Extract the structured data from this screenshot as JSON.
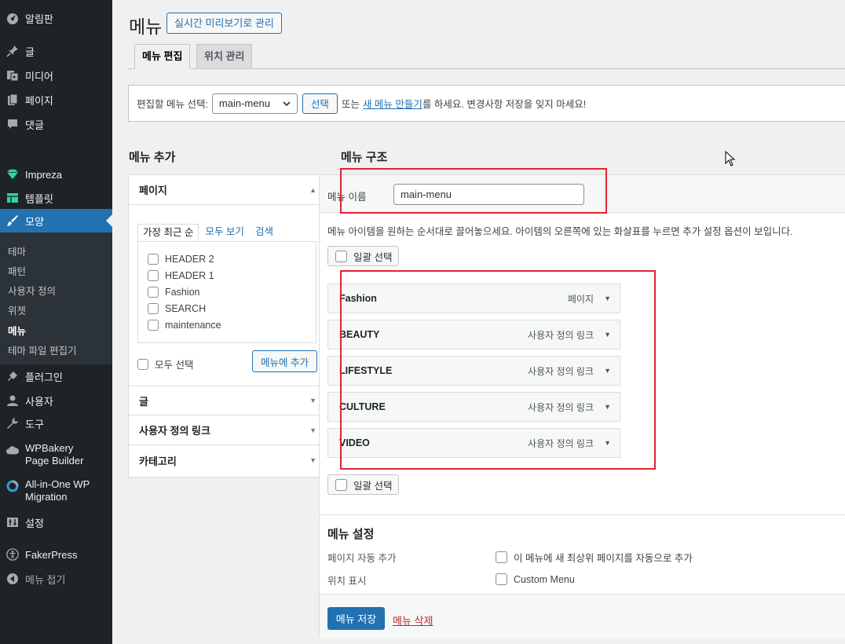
{
  "sidebar": {
    "items": [
      {
        "label": "알림판",
        "icon": "dashboard-icon"
      },
      {
        "label": "글",
        "icon": "pin-icon"
      },
      {
        "label": "미디어",
        "icon": "media-icon"
      },
      {
        "label": "페이지",
        "icon": "page-icon"
      },
      {
        "label": "댓글",
        "icon": "comment-icon"
      },
      {
        "label": "Impreza",
        "icon": "diamond-icon"
      },
      {
        "label": "템플릿",
        "icon": "template-icon"
      },
      {
        "label": "모양",
        "icon": "brush-icon"
      },
      {
        "label": "플러그인",
        "icon": "plugin-icon"
      },
      {
        "label": "사용자",
        "icon": "user-icon"
      },
      {
        "label": "도구",
        "icon": "wrench-icon"
      },
      {
        "label": "WPBakery Page Builder",
        "icon": "cloud-icon"
      },
      {
        "label": "All-in-One WP Migration",
        "icon": "migration-icon"
      },
      {
        "label": "설정",
        "icon": "settings-icon"
      },
      {
        "label": "FakerPress",
        "icon": "accessibility-icon"
      },
      {
        "label": "메뉴 접기",
        "icon": "collapse-icon"
      }
    ],
    "submenu": [
      "테마",
      "패턴",
      "사용자 정의",
      "위젯",
      "메뉴",
      "테마 파일 편집기"
    ]
  },
  "header": {
    "title": "메뉴",
    "live_preview": "실시간 미리보기로 관리"
  },
  "tabs": [
    "메뉴 편집",
    "위치 관리"
  ],
  "manage": {
    "label": "편집할 메뉴 선택:",
    "selected": "main-menu",
    "select_button": "선택",
    "text_before": "또는",
    "create_link": "새 메뉴 만들기",
    "text_after": "를 하세요. 변경사항 저장을 잊지 마세요!"
  },
  "add_menu": {
    "title": "메뉴 추가",
    "pages_title": "페이지",
    "tabs": [
      "가장 최근 순",
      "모두 보기",
      "검색"
    ],
    "pages": [
      "HEADER 2",
      "HEADER 1",
      "Fashion",
      "SEARCH",
      "maintenance"
    ],
    "select_all": "모두 선택",
    "add_button": "메뉴에 추가",
    "sections": [
      "글",
      "사용자 정의 링크",
      "카테고리"
    ]
  },
  "structure": {
    "title": "메뉴 구조",
    "name_label": "메뉴 이름",
    "name_value": "main-menu",
    "instructions": "메뉴 아이템을 원하는 순서대로 끌어놓으세요. 아이템의 오른쪽에 있는 화살표를 누르면 추가 설정 옵션이 보입니다.",
    "bulk_select": "일괄 선택",
    "items": [
      {
        "title": "Fashion",
        "type": "페이지"
      },
      {
        "title": "BEAUTY",
        "type": "사용자 정의 링크"
      },
      {
        "title": "LIFESTYLE",
        "type": "사용자 정의 링크"
      },
      {
        "title": "CULTURE",
        "type": "사용자 정의 링크"
      },
      {
        "title": "VIDEO",
        "type": "사용자 정의 링크"
      }
    ]
  },
  "settings": {
    "title": "메뉴 설정",
    "auto_add_label": "페이지 자동 추가",
    "auto_add_option": "이 메뉴에 새 최상위 페이지를 자동으로 추가",
    "location_label": "위치 표시",
    "location_option": "Custom Menu"
  },
  "footer": {
    "save": "메뉴 저장",
    "delete": "메뉴 삭제"
  },
  "colors": {
    "accent": "#2271b1",
    "highlight": "#e12330",
    "sidebar": "#1d2327"
  }
}
